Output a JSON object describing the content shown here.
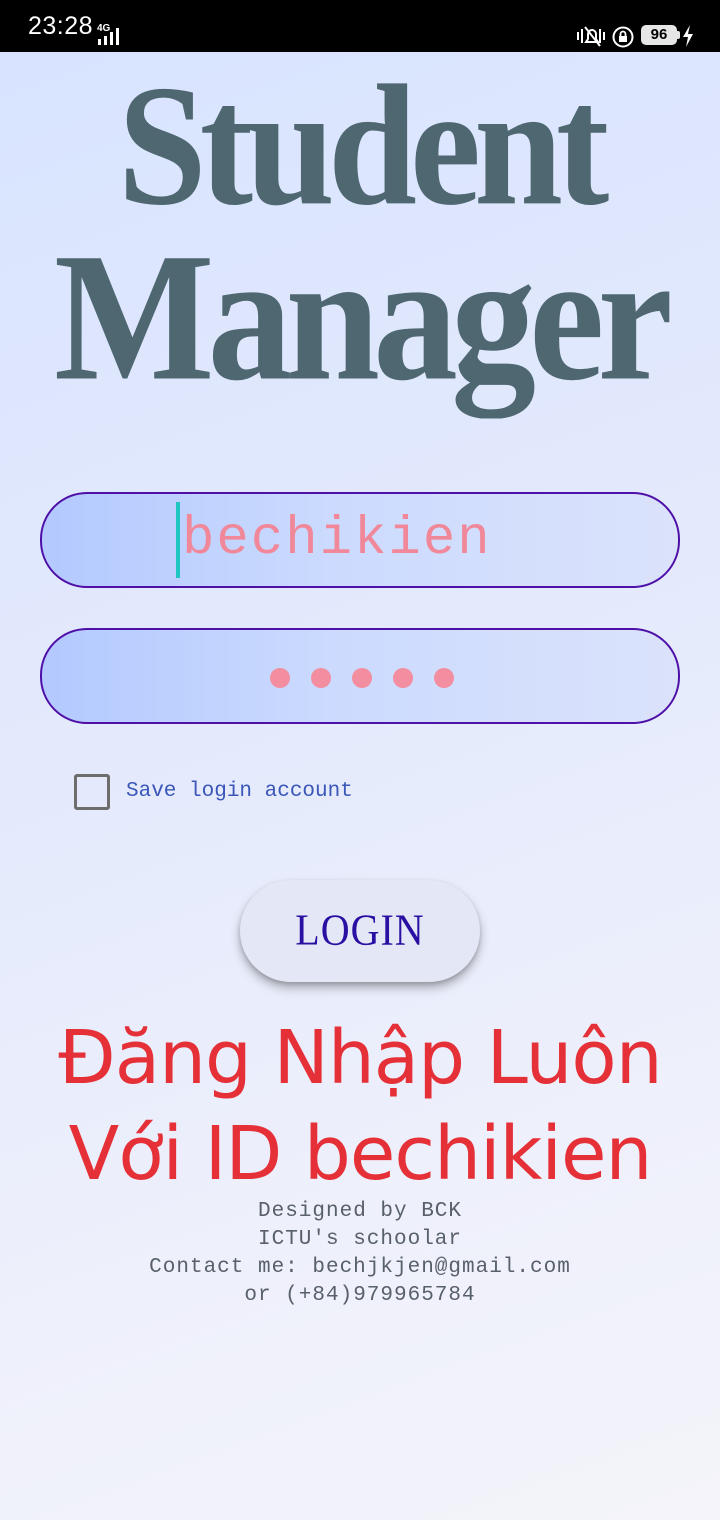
{
  "status_bar": {
    "time": "23:28",
    "network_type": "4G",
    "battery_level": "96",
    "icons": [
      "signal-icon",
      "vibrate-icon",
      "rotation-lock-icon",
      "battery-icon",
      "charging-icon"
    ]
  },
  "app": {
    "title_line1": "Student",
    "title_line2": "Manager"
  },
  "login_form": {
    "username_value": "bechikien",
    "password_masked_length": 5,
    "save_login_label": "Save login account",
    "save_login_checked": false,
    "login_button_label": "LOGIN"
  },
  "caption": {
    "line1": "Đăng Nhập Luôn",
    "line2": "Với ID bechikien"
  },
  "footer": {
    "line1": "Designed by BCK",
    "line2": "ICTU's schoolar",
    "line3": "Contact me: bechjkjen@gmail.com",
    "line4": "or (+84)979965784"
  },
  "colors": {
    "title": "#4e6770",
    "input_border": "#4f10a8",
    "input_text": "#f0889a",
    "caret": "#1ec7c0",
    "checkbox_label": "#3a56b8",
    "login_label": "#2a0fa3",
    "caption": "#e53038",
    "footer": "#58606a"
  }
}
